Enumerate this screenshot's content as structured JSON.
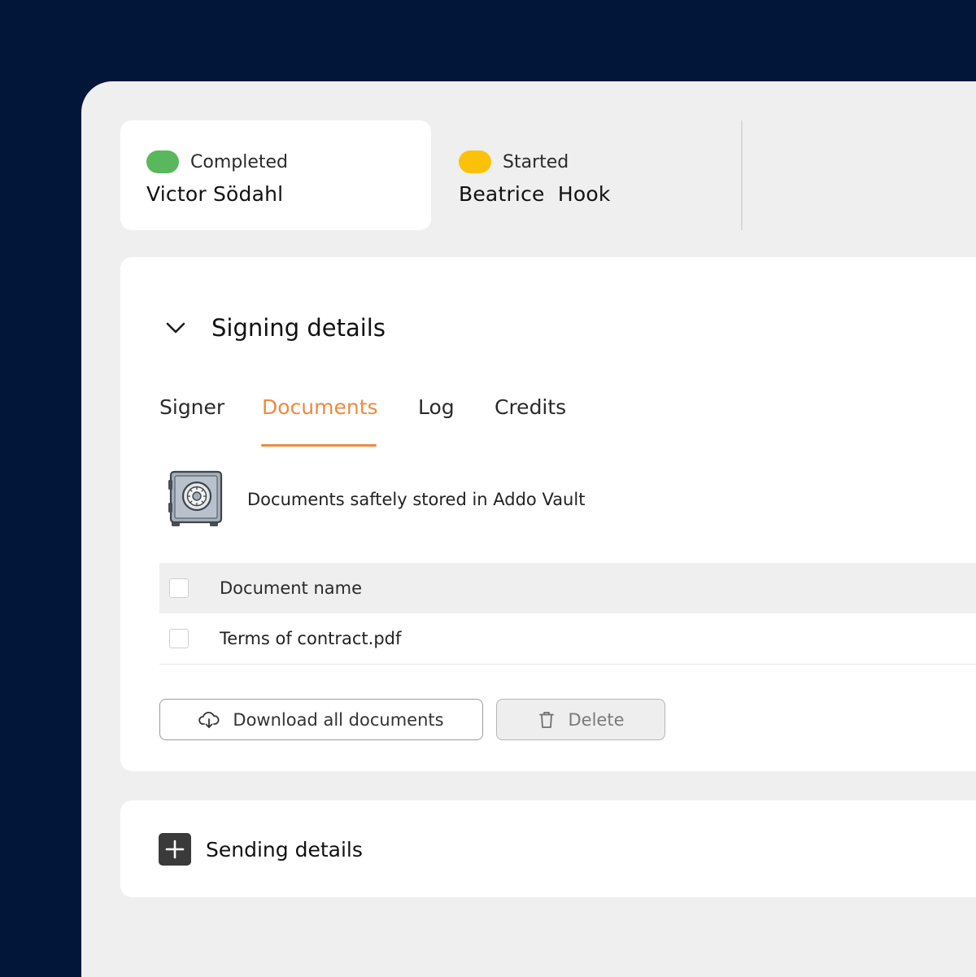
{
  "signers": [
    {
      "status": "Completed",
      "name": "Victor Södahl",
      "status_color": "#59b85c"
    },
    {
      "status": "Started",
      "name": "Beatrice  Hook",
      "status_color": "#fcc20a"
    }
  ],
  "signing_details": {
    "title": "Signing details",
    "tabs": [
      {
        "label": "Signer",
        "selected": false
      },
      {
        "label": "Documents",
        "selected": true
      },
      {
        "label": "Log",
        "selected": false
      },
      {
        "label": "Credits",
        "selected": false
      }
    ],
    "vault_message": "Documents saftely stored in Addo Vault",
    "table": {
      "column_header": "Document name",
      "rows": [
        {
          "name": "Terms of contract.pdf"
        }
      ]
    },
    "buttons": {
      "download": "Download all documents",
      "delete": "Delete"
    }
  },
  "sending_details": {
    "title": "Sending details"
  },
  "colors": {
    "accent": "#ef8a3f",
    "background": "#021639",
    "completed": "#59b85c",
    "started": "#fcc20a"
  },
  "icons": {
    "chevron": "chevron-down-icon",
    "vault": "safe-vault-icon",
    "download": "cloud-download-icon",
    "delete": "trash-icon",
    "expand": "plus-icon"
  }
}
